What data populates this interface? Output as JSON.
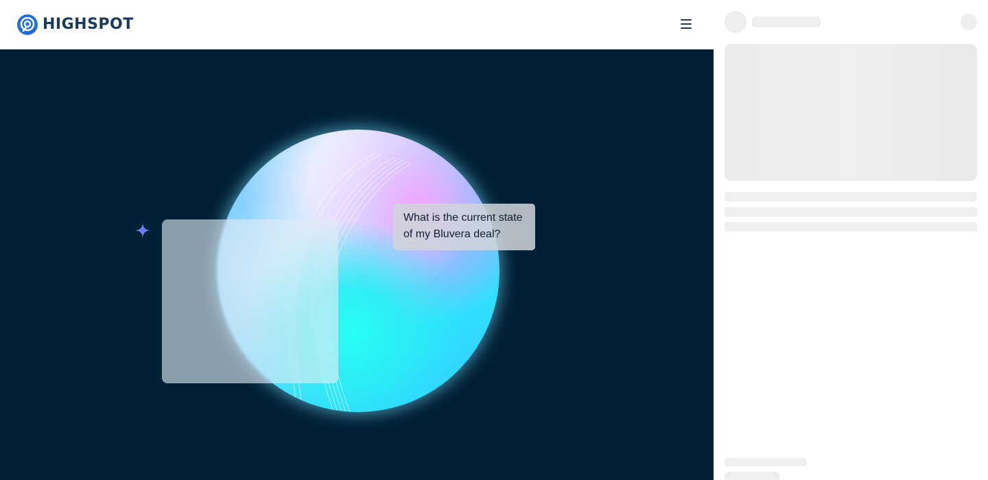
{
  "header": {
    "logo_text": "HIGHSPOT",
    "menu_icon": "hamburger-menu-icon"
  },
  "hero": {
    "chat_line_1": "What is the current state",
    "chat_line_2": "of my Bluvera deal?",
    "sparkle_icon": "sparkle-icon"
  },
  "colors": {
    "brand_blue": "#1f6fd6",
    "logo_text": "#1a3a5c",
    "hero_bg": "#002035",
    "skeleton": "#efefef"
  },
  "panel": {
    "state": "loading"
  }
}
